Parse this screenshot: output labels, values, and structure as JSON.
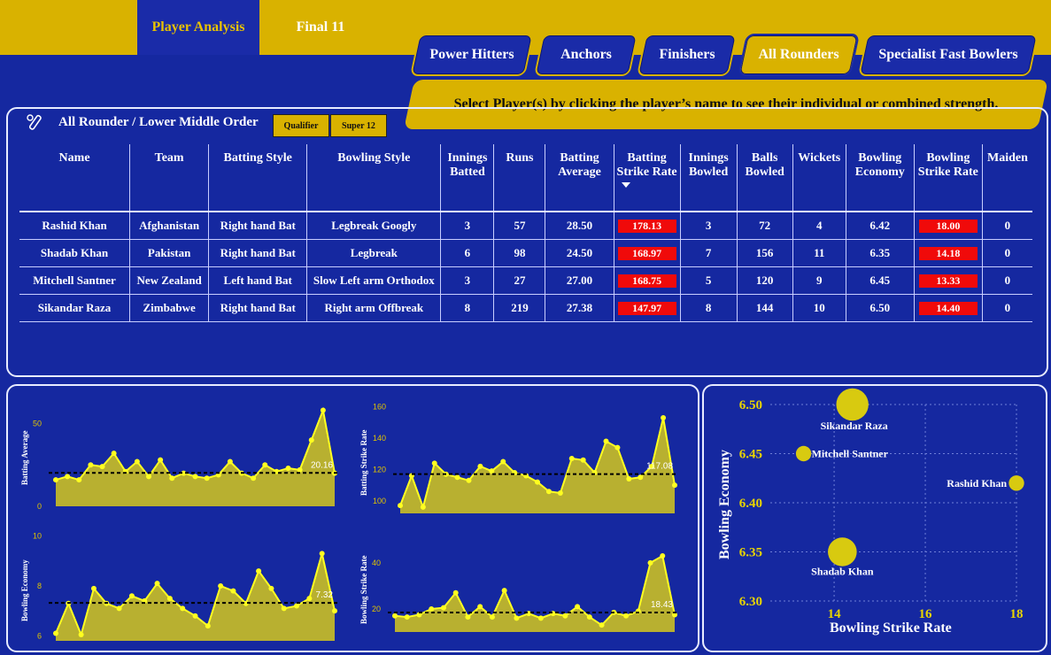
{
  "nav": {
    "tabs": [
      {
        "label": "Player Analysis",
        "active": true
      },
      {
        "label": "Final 11",
        "active": false
      }
    ]
  },
  "categories": [
    {
      "label": "Power Hitters",
      "active": false
    },
    {
      "label": "Anchors",
      "active": false
    },
    {
      "label": "Finishers",
      "active": false
    },
    {
      "label": "All Rounders",
      "active": true
    },
    {
      "label": "Specialist Fast Bowlers",
      "active": false
    }
  ],
  "hint": "Select Player(s) by clicking the player’s name to see their individual or combined strength.",
  "table_section": {
    "title": "All Rounder / Lower Middle Order",
    "filters": [
      "Qualifier",
      "Super 12"
    ],
    "icon": "cricket-bat-icon"
  },
  "table": {
    "headers": [
      "Name",
      "Team",
      "Batting Style",
      "Bowling Style",
      "Innings Batted",
      "Runs",
      "Batting Average",
      "Batting Strike Rate",
      "Innings Bowled",
      "Balls Bowled",
      "Wickets",
      "Bowling Economy",
      "Bowling Strike Rate",
      "Maiden"
    ],
    "rows": [
      [
        "Rashid Khan",
        "Afghanistan",
        "Right hand Bat",
        "Legbreak Googly",
        "3",
        "57",
        "28.50",
        "178.13",
        "3",
        "72",
        "4",
        "6.42",
        "18.00",
        "0"
      ],
      [
        "Shadab Khan",
        "Pakistan",
        "Right hand Bat",
        "Legbreak",
        "6",
        "98",
        "24.50",
        "168.97",
        "7",
        "156",
        "11",
        "6.35",
        "14.18",
        "0"
      ],
      [
        "Mitchell Santner",
        "New Zealand",
        "Left hand Bat",
        "Slow Left arm Orthodox",
        "3",
        "27",
        "27.00",
        "168.75",
        "5",
        "120",
        "9",
        "6.45",
        "13.33",
        "0"
      ],
      [
        "Sikandar Raza",
        "Zimbabwe",
        "Right hand Bat",
        "Right arm Offbreak",
        "8",
        "219",
        "27.38",
        "147.97",
        "8",
        "144",
        "10",
        "6.50",
        "14.40",
        "0"
      ]
    ],
    "highlight_color": "#f00a0a"
  },
  "colors": {
    "background": "#1528a0",
    "accent": "#d9b200",
    "area_fill": "#b8b030",
    "point": "#ffff20"
  },
  "chart_data": [
    {
      "type": "area",
      "ylabel": "Batting Average",
      "yticks": [
        0,
        50
      ],
      "ylim": [
        0,
        62
      ],
      "reference_value": 20.16,
      "reference_label": "20.16",
      "values": [
        16,
        18,
        16,
        25,
        24,
        32,
        21,
        27,
        18,
        28,
        17,
        20,
        18,
        17,
        19,
        27,
        20,
        17,
        25,
        21,
        23,
        22,
        40,
        58,
        20
      ]
    },
    {
      "type": "area",
      "ylabel": "Batting Strike Rate",
      "yticks": [
        100,
        120,
        140,
        160
      ],
      "ylim": [
        92,
        162
      ],
      "reference_value": 117.08,
      "reference_label": "117.08",
      "values": [
        97,
        116,
        96,
        124,
        117,
        115,
        113,
        122,
        119,
        125,
        118,
        116,
        112,
        106,
        105,
        127,
        126,
        118,
        138,
        134,
        114,
        115,
        122,
        153,
        110
      ]
    },
    {
      "type": "area",
      "ylabel": "Bowling Economy",
      "yticks": [
        6,
        8,
        10
      ],
      "ylim": [
        5.8,
        10.2
      ],
      "reference_value": 7.32,
      "reference_label": "7.32",
      "values": [
        6.1,
        7.3,
        6.05,
        7.9,
        7.3,
        7.1,
        7.6,
        7.4,
        8.1,
        7.5,
        7.1,
        6.8,
        6.4,
        8.0,
        7.8,
        7.3,
        8.6,
        7.9,
        7.1,
        7.2,
        7.5,
        9.3,
        7.0
      ]
    },
    {
      "type": "area",
      "ylabel": "Bowling Strike Rate",
      "yticks": [
        20,
        40
      ],
      "ylim": [
        10,
        48
      ],
      "reference_value": 18.43,
      "reference_label": "18.43",
      "values": [
        17,
        16.5,
        17.5,
        20,
        20.5,
        27,
        16.5,
        21,
        16.5,
        28,
        16,
        18,
        16,
        18,
        17,
        21,
        16.5,
        13,
        18.5,
        17,
        19,
        40,
        43,
        17.5
      ]
    },
    {
      "type": "scatter",
      "xlabel": "Bowling Strike Rate",
      "ylabel": "Bowling Economy",
      "xticks": [
        14,
        16,
        18
      ],
      "yticks": [
        6.3,
        6.35,
        6.4,
        6.45,
        6.5
      ],
      "xlim": [
        12.6,
        18.0
      ],
      "ylim": [
        6.3,
        6.5
      ],
      "points": [
        {
          "name": "Sikandar Raza",
          "x": 14.4,
          "y": 6.5,
          "size": 8
        },
        {
          "name": "Mitchell Santner",
          "x": 13.33,
          "y": 6.45,
          "size": 3
        },
        {
          "name": "Rashid Khan",
          "x": 18.0,
          "y": 6.42,
          "size": 3
        },
        {
          "name": "Shadab Khan",
          "x": 14.18,
          "y": 6.35,
          "size": 7
        }
      ]
    }
  ]
}
